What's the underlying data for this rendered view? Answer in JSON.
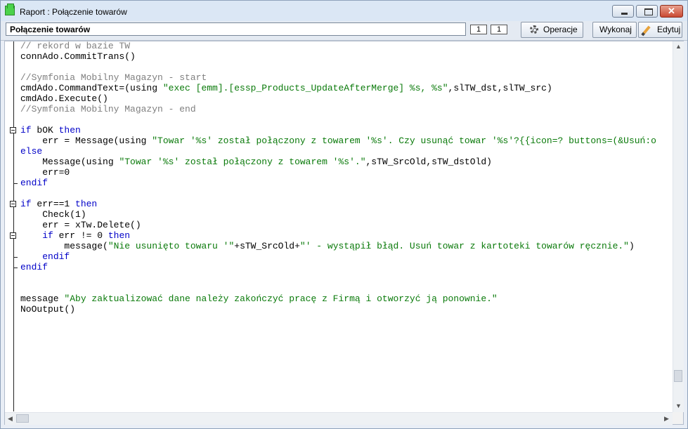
{
  "window": {
    "title": "Raport : Połączenie towarów",
    "minimize_glyph": "–",
    "restore_glyph": "□",
    "close_glyph": "✕"
  },
  "toolbar": {
    "report_name": "Połączenie towarów",
    "page_current": "1",
    "page_total": "1",
    "operations_label": "Operacje",
    "execute_label": "Wykonaj",
    "edit_label": "Edytuj"
  },
  "editor": {
    "lines": [
      [
        {
          "t": "// rekord w bazie TW",
          "c": "com"
        }
      ],
      [
        {
          "t": "connAdo.CommitTrans()",
          "c": "txt"
        }
      ],
      [],
      [
        {
          "t": "//Symfonia Mobilny Magazyn - start",
          "c": "com"
        }
      ],
      [
        {
          "t": "cmdAdo.CommandText=(using ",
          "c": "txt"
        },
        {
          "t": "\"exec [emm].[essp_Products_UpdateAfterMerge] %s, %s\"",
          "c": "str"
        },
        {
          "t": ",slTW_dst,slTW_src)",
          "c": "txt"
        }
      ],
      [
        {
          "t": "cmdAdo.Execute()",
          "c": "txt"
        }
      ],
      [
        {
          "t": "//Symfonia Mobilny Magazyn - end",
          "c": "com"
        }
      ],
      [],
      [
        {
          "t": "if",
          "c": "kw"
        },
        {
          "t": " bOK ",
          "c": "txt"
        },
        {
          "t": "then",
          "c": "kw"
        }
      ],
      [
        {
          "t": "    err = Message(using ",
          "c": "txt"
        },
        {
          "t": "\"Towar '%s' został połączony z towarem '%s'. Czy usunąć towar '%s'?{{icon=? buttons=(&Usuń:o",
          "c": "str"
        }
      ],
      [
        {
          "t": "else",
          "c": "kw"
        }
      ],
      [
        {
          "t": "    Message(using ",
          "c": "txt"
        },
        {
          "t": "\"Towar '%s' został połączony z towarem '%s'.\"",
          "c": "str"
        },
        {
          "t": ",sTW_SrcOld,sTW_dstOld)",
          "c": "txt"
        }
      ],
      [
        {
          "t": "    err=0",
          "c": "txt"
        }
      ],
      [
        {
          "t": "endif",
          "c": "kw"
        }
      ],
      [],
      [
        {
          "t": "if",
          "c": "kw"
        },
        {
          "t": " err==1 ",
          "c": "txt"
        },
        {
          "t": "then",
          "c": "kw"
        }
      ],
      [
        {
          "t": "    Check(1)",
          "c": "txt"
        }
      ],
      [
        {
          "t": "    err = xTw.Delete()",
          "c": "txt"
        }
      ],
      [
        {
          "t": "    ",
          "c": "txt"
        },
        {
          "t": "if",
          "c": "kw"
        },
        {
          "t": " err != 0 ",
          "c": "txt"
        },
        {
          "t": "then",
          "c": "kw"
        }
      ],
      [
        {
          "t": "        message(",
          "c": "txt"
        },
        {
          "t": "\"Nie usunięto towaru '\"",
          "c": "str"
        },
        {
          "t": "+sTW_SrcOld+",
          "c": "txt"
        },
        {
          "t": "\"' - wystąpił błąd. Usuń towar z kartoteki towarów ręcznie.\"",
          "c": "str"
        },
        {
          "t": ")",
          "c": "txt"
        }
      ],
      [
        {
          "t": "    ",
          "c": "txt"
        },
        {
          "t": "endif",
          "c": "kw"
        }
      ],
      [
        {
          "t": "endif",
          "c": "kw"
        }
      ],
      [],
      [],
      [
        {
          "t": "message ",
          "c": "txt"
        },
        {
          "t": "\"Aby zaktualizować dane należy zakończyć pracę z Firmą i otworzyć ją ponownie.\"",
          "c": "str"
        }
      ],
      [
        {
          "t": "NoOutput()",
          "c": "txt"
        }
      ]
    ]
  },
  "colors": {
    "keyword": "#0000c8",
    "string": "#0a7a0a",
    "comment": "#7f7f7f"
  }
}
